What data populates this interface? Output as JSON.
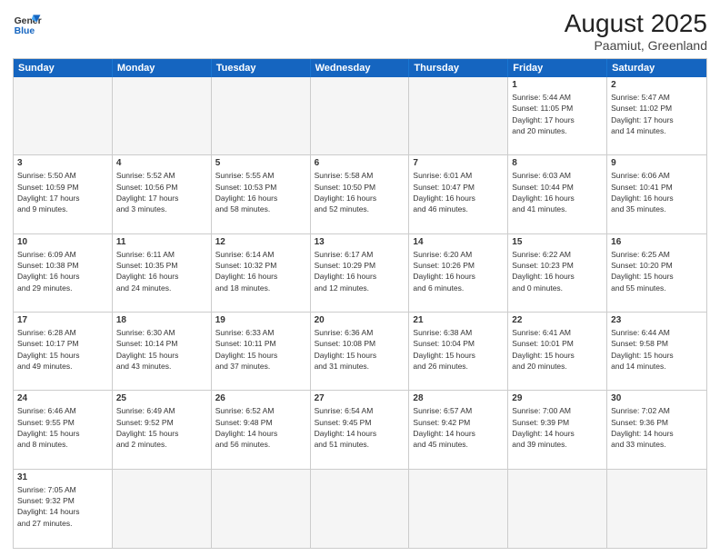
{
  "header": {
    "logo_general": "General",
    "logo_blue": "Blue",
    "title": "August 2025",
    "subtitle": "Paamiut, Greenland"
  },
  "weekdays": [
    "Sunday",
    "Monday",
    "Tuesday",
    "Wednesday",
    "Thursday",
    "Friday",
    "Saturday"
  ],
  "cells": [
    {
      "day": null,
      "empty": true
    },
    {
      "day": null,
      "empty": true
    },
    {
      "day": null,
      "empty": true
    },
    {
      "day": null,
      "empty": true
    },
    {
      "day": null,
      "empty": true
    },
    {
      "day": "1",
      "info": "Sunrise: 5:44 AM\nSunset: 11:05 PM\nDaylight: 17 hours\nand 20 minutes."
    },
    {
      "day": "2",
      "info": "Sunrise: 5:47 AM\nSunset: 11:02 PM\nDaylight: 17 hours\nand 14 minutes."
    },
    {
      "day": "3",
      "info": "Sunrise: 5:50 AM\nSunset: 10:59 PM\nDaylight: 17 hours\nand 9 minutes."
    },
    {
      "day": "4",
      "info": "Sunrise: 5:52 AM\nSunset: 10:56 PM\nDaylight: 17 hours\nand 3 minutes."
    },
    {
      "day": "5",
      "info": "Sunrise: 5:55 AM\nSunset: 10:53 PM\nDaylight: 16 hours\nand 58 minutes."
    },
    {
      "day": "6",
      "info": "Sunrise: 5:58 AM\nSunset: 10:50 PM\nDaylight: 16 hours\nand 52 minutes."
    },
    {
      "day": "7",
      "info": "Sunrise: 6:01 AM\nSunset: 10:47 PM\nDaylight: 16 hours\nand 46 minutes."
    },
    {
      "day": "8",
      "info": "Sunrise: 6:03 AM\nSunset: 10:44 PM\nDaylight: 16 hours\nand 41 minutes."
    },
    {
      "day": "9",
      "info": "Sunrise: 6:06 AM\nSunset: 10:41 PM\nDaylight: 16 hours\nand 35 minutes."
    },
    {
      "day": "10",
      "info": "Sunrise: 6:09 AM\nSunset: 10:38 PM\nDaylight: 16 hours\nand 29 minutes."
    },
    {
      "day": "11",
      "info": "Sunrise: 6:11 AM\nSunset: 10:35 PM\nDaylight: 16 hours\nand 24 minutes."
    },
    {
      "day": "12",
      "info": "Sunrise: 6:14 AM\nSunset: 10:32 PM\nDaylight: 16 hours\nand 18 minutes."
    },
    {
      "day": "13",
      "info": "Sunrise: 6:17 AM\nSunset: 10:29 PM\nDaylight: 16 hours\nand 12 minutes."
    },
    {
      "day": "14",
      "info": "Sunrise: 6:20 AM\nSunset: 10:26 PM\nDaylight: 16 hours\nand 6 minutes."
    },
    {
      "day": "15",
      "info": "Sunrise: 6:22 AM\nSunset: 10:23 PM\nDaylight: 16 hours\nand 0 minutes."
    },
    {
      "day": "16",
      "info": "Sunrise: 6:25 AM\nSunset: 10:20 PM\nDaylight: 15 hours\nand 55 minutes."
    },
    {
      "day": "17",
      "info": "Sunrise: 6:28 AM\nSunset: 10:17 PM\nDaylight: 15 hours\nand 49 minutes."
    },
    {
      "day": "18",
      "info": "Sunrise: 6:30 AM\nSunset: 10:14 PM\nDaylight: 15 hours\nand 43 minutes."
    },
    {
      "day": "19",
      "info": "Sunrise: 6:33 AM\nSunset: 10:11 PM\nDaylight: 15 hours\nand 37 minutes."
    },
    {
      "day": "20",
      "info": "Sunrise: 6:36 AM\nSunset: 10:08 PM\nDaylight: 15 hours\nand 31 minutes."
    },
    {
      "day": "21",
      "info": "Sunrise: 6:38 AM\nSunset: 10:04 PM\nDaylight: 15 hours\nand 26 minutes."
    },
    {
      "day": "22",
      "info": "Sunrise: 6:41 AM\nSunset: 10:01 PM\nDaylight: 15 hours\nand 20 minutes."
    },
    {
      "day": "23",
      "info": "Sunrise: 6:44 AM\nSunset: 9:58 PM\nDaylight: 15 hours\nand 14 minutes."
    },
    {
      "day": "24",
      "info": "Sunrise: 6:46 AM\nSunset: 9:55 PM\nDaylight: 15 hours\nand 8 minutes."
    },
    {
      "day": "25",
      "info": "Sunrise: 6:49 AM\nSunset: 9:52 PM\nDaylight: 15 hours\nand 2 minutes."
    },
    {
      "day": "26",
      "info": "Sunrise: 6:52 AM\nSunset: 9:48 PM\nDaylight: 14 hours\nand 56 minutes."
    },
    {
      "day": "27",
      "info": "Sunrise: 6:54 AM\nSunset: 9:45 PM\nDaylight: 14 hours\nand 51 minutes."
    },
    {
      "day": "28",
      "info": "Sunrise: 6:57 AM\nSunset: 9:42 PM\nDaylight: 14 hours\nand 45 minutes."
    },
    {
      "day": "29",
      "info": "Sunrise: 7:00 AM\nSunset: 9:39 PM\nDaylight: 14 hours\nand 39 minutes."
    },
    {
      "day": "30",
      "info": "Sunrise: 7:02 AM\nSunset: 9:36 PM\nDaylight: 14 hours\nand 33 minutes."
    },
    {
      "day": "31",
      "info": "Sunrise: 7:05 AM\nSunset: 9:32 PM\nDaylight: 14 hours\nand 27 minutes."
    },
    {
      "day": null,
      "empty": true
    },
    {
      "day": null,
      "empty": true
    },
    {
      "day": null,
      "empty": true
    },
    {
      "day": null,
      "empty": true
    },
    {
      "day": null,
      "empty": true
    },
    {
      "day": null,
      "empty": true
    }
  ]
}
